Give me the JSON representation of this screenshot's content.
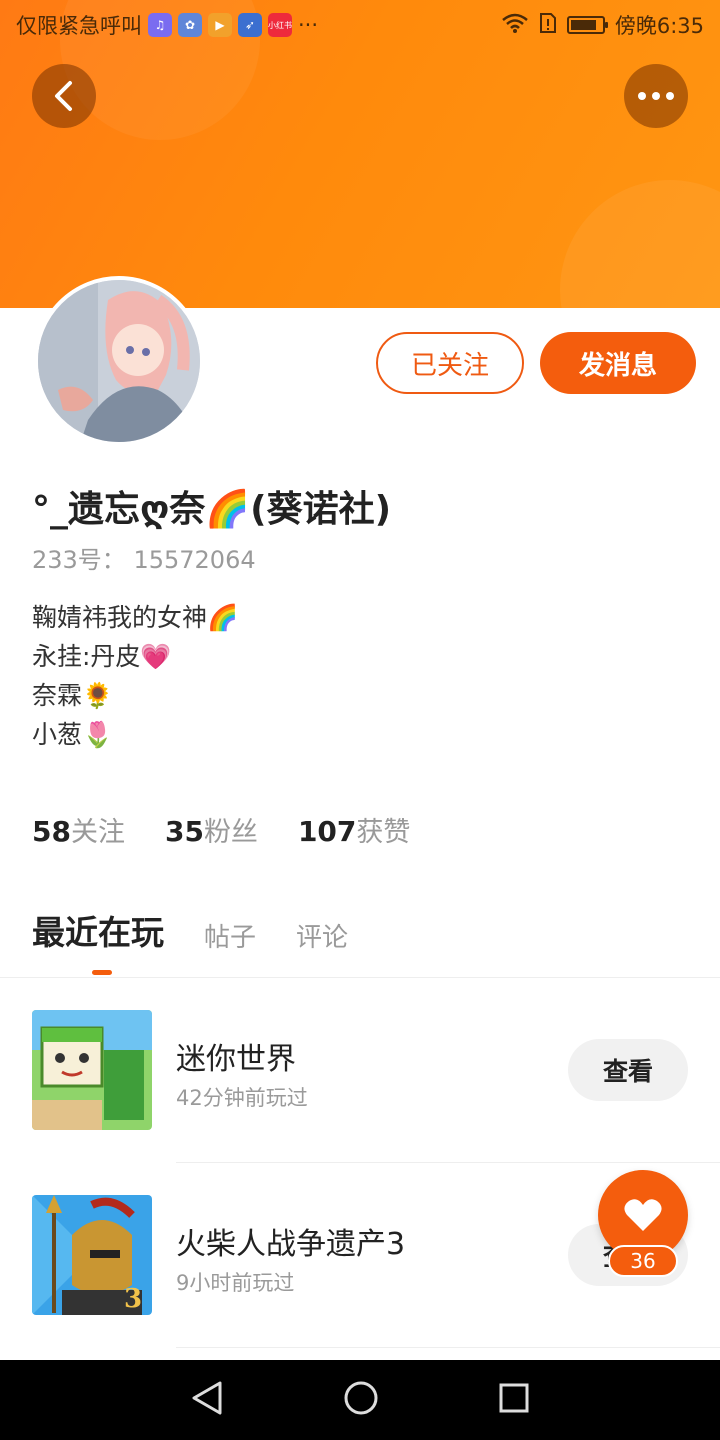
{
  "status_bar": {
    "carrier_text": "仅限紧急呼叫",
    "app_icons": [
      "music-icon",
      "paw-icon",
      "play-icon",
      "feather-icon",
      "xiaohongshu-icon"
    ],
    "xiaohongshu_label": "小红书",
    "more": "···",
    "time": "傍晚6:35",
    "battery_level": 0.85
  },
  "header": {
    "back_icon": "chevron-left-icon",
    "more_icon": "more-horizontal-icon",
    "more_label": "•••"
  },
  "profile": {
    "username": "°_遗忘ღ奈🌈(葵诺社)",
    "id_label": "233号：",
    "id_value": "15572064",
    "bio_lines": [
      "鞠婧祎我的女神🌈",
      "永挂:丹皮💗",
      "奈霖🌻",
      "小葱🌷"
    ],
    "followed_label": "已关注",
    "message_label": "发消息"
  },
  "stats": {
    "following_count": "58",
    "following_label": "关注",
    "fans_count": "35",
    "fans_label": "粉丝",
    "likes_count": "107",
    "likes_label": "获赞"
  },
  "tabs": [
    {
      "label": "最近在玩",
      "active": true
    },
    {
      "label": "帖子",
      "active": false
    },
    {
      "label": "评论",
      "active": false
    }
  ],
  "games": [
    {
      "name": "迷你世界",
      "time": "42分钟前玩过",
      "action": "查看"
    },
    {
      "name": "火柴人战争遗产3",
      "time": "9小时前玩过",
      "action": "查看"
    }
  ],
  "fab": {
    "icon": "heart-icon",
    "count": "36"
  },
  "nav": {
    "back": "triangle-back-icon",
    "home": "circle-home-icon",
    "recent": "square-recent-icon"
  },
  "colors": {
    "accent": "#f45d0d",
    "banner": "#ff8a0c"
  }
}
